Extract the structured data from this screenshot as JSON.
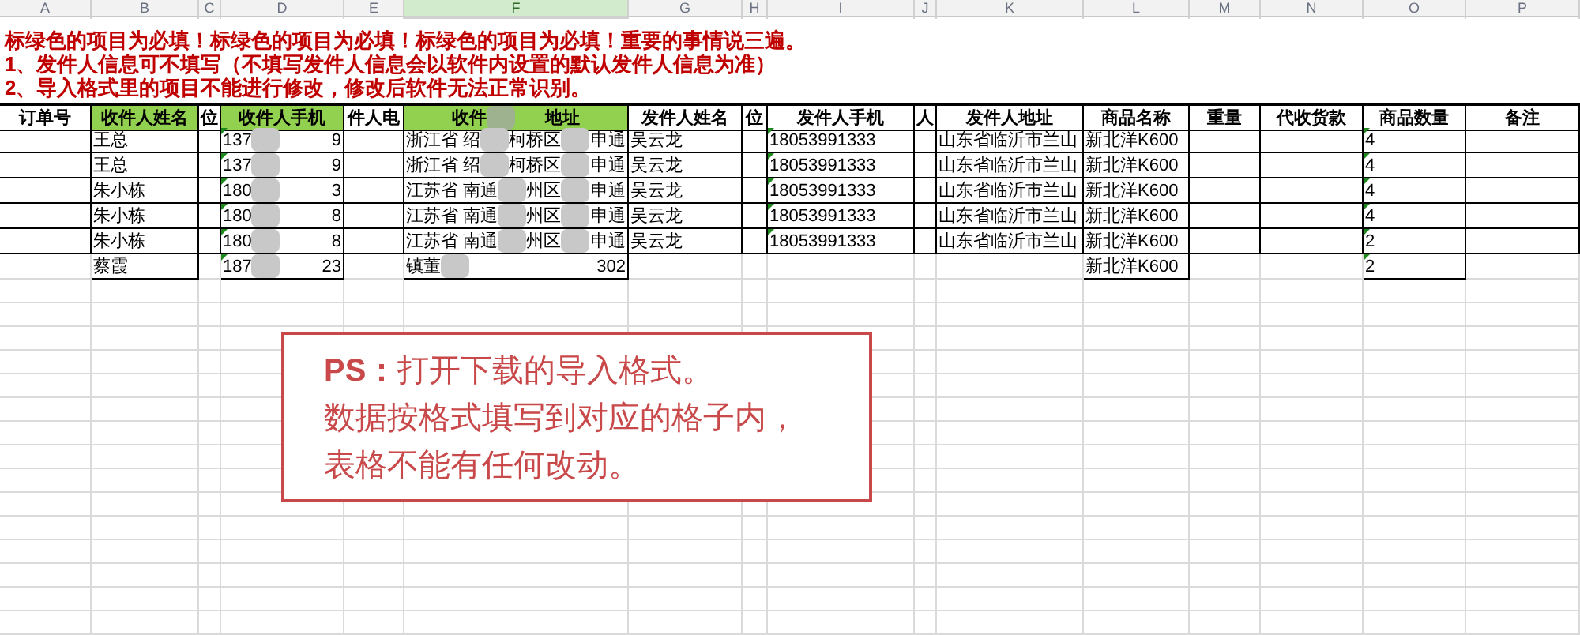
{
  "column_letters": [
    {
      "label": "A",
      "selected": false
    },
    {
      "label": "B",
      "selected": false
    },
    {
      "label": "C",
      "selected": false
    },
    {
      "label": "D",
      "selected": false
    },
    {
      "label": "E",
      "selected": false
    },
    {
      "label": "F",
      "selected": true
    },
    {
      "label": "G",
      "selected": false
    },
    {
      "label": "H",
      "selected": false
    },
    {
      "label": "I",
      "selected": false
    },
    {
      "label": "J",
      "selected": false
    },
    {
      "label": "K",
      "selected": false
    },
    {
      "label": "L",
      "selected": false
    },
    {
      "label": "M",
      "selected": false
    },
    {
      "label": "N",
      "selected": false
    },
    {
      "label": "O",
      "selected": false
    },
    {
      "label": "P",
      "selected": false
    }
  ],
  "notes": [
    "标绿色的项目为必填！标绿色的项目为必填！标绿色的项目为必填！重要的事情说三遍。",
    "1、发件人信息可不填写（不填写发件人信息会以软件内设置的默认发件人信息为准）",
    "2、导入格式里的项目不能进行修改，修改后软件无法正常识别。"
  ],
  "table": {
    "columns": [
      {
        "label": [
          "订单号"
        ],
        "required": false,
        "number_as_text": false
      },
      {
        "label": [
          "收件人姓名"
        ],
        "required": true,
        "number_as_text": false
      },
      {
        "label": [
          "位"
        ],
        "required": false,
        "number_as_text": false
      },
      {
        "label": [
          "收件人手机"
        ],
        "required": true,
        "number_as_text": true
      },
      {
        "label": [
          "件人电"
        ],
        "required": false,
        "number_as_text": false
      },
      {
        "label": [
          "收件",
          "地址"
        ],
        "required": true,
        "number_as_text": false
      },
      {
        "label": [
          "发件人姓名"
        ],
        "required": false,
        "number_as_text": false
      },
      {
        "label": [
          "位"
        ],
        "required": false,
        "number_as_text": false
      },
      {
        "label": [
          "发件人手机"
        ],
        "required": false,
        "number_as_text": true
      },
      {
        "label": [
          "人"
        ],
        "required": false,
        "number_as_text": false
      },
      {
        "label": [
          "发件人地址"
        ],
        "required": false,
        "number_as_text": false
      },
      {
        "label": [
          "商品名称"
        ],
        "required": false,
        "number_as_text": false
      },
      {
        "label": [
          "重量"
        ],
        "required": false,
        "number_as_text": false
      },
      {
        "label": [
          "代收货款"
        ],
        "required": false,
        "number_as_text": false
      },
      {
        "label": [
          "商品数量"
        ],
        "required": false,
        "number_as_text": true
      },
      {
        "label": [
          "备注"
        ],
        "required": false,
        "number_as_text": false
      }
    ],
    "rows": [
      {
        "cells": {
          "B": [
            "王总"
          ],
          "D": [
            "137",
            "9"
          ],
          "F": [
            "浙江省 绍",
            "柯桥区",
            "申通"
          ],
          "G": [
            "吴云龙"
          ],
          "I": [
            "18053991333"
          ],
          "K": [
            "山东省临沂市兰山"
          ],
          "L": [
            "新北洋K600"
          ],
          "O": [
            "4"
          ]
        }
      },
      {
        "cells": {
          "B": [
            "王总"
          ],
          "D": [
            "137",
            "9"
          ],
          "F": [
            "浙江省 绍",
            "柯桥区",
            "申通"
          ],
          "G": [
            "吴云龙"
          ],
          "I": [
            "18053991333"
          ],
          "K": [
            "山东省临沂市兰山"
          ],
          "L": [
            "新北洋K600"
          ],
          "O": [
            "4"
          ]
        }
      },
      {
        "cells": {
          "B": [
            "朱小栋"
          ],
          "D": [
            "180",
            "3"
          ],
          "F": [
            "江苏省 南通",
            "州区",
            "申通"
          ],
          "G": [
            "吴云龙"
          ],
          "I": [
            "18053991333"
          ],
          "K": [
            "山东省临沂市兰山"
          ],
          "L": [
            "新北洋K600"
          ],
          "O": [
            "4"
          ]
        }
      },
      {
        "cells": {
          "B": [
            "朱小栋"
          ],
          "D": [
            "180",
            "8"
          ],
          "F": [
            "江苏省 南通",
            "州区",
            "申通"
          ],
          "G": [
            "吴云龙"
          ],
          "I": [
            "18053991333"
          ],
          "K": [
            "山东省临沂市兰山"
          ],
          "L": [
            "新北洋K600"
          ],
          "O": [
            "4"
          ]
        }
      },
      {
        "cells": {
          "B": [
            "朱小栋"
          ],
          "D": [
            "180",
            "8"
          ],
          "F": [
            "江苏省 南通",
            "州区",
            "申通"
          ],
          "G": [
            "吴云龙"
          ],
          "I": [
            "18053991333"
          ],
          "K": [
            "山东省临沂市兰山"
          ],
          "L": [
            "新北洋K600"
          ],
          "O": [
            "2"
          ]
        }
      },
      {
        "cells": {
          "B": [
            "蔡霞"
          ],
          "D": [
            "187",
            "23"
          ],
          "F": [
            "镇董",
            "302"
          ],
          "L": [
            "新北洋K600"
          ],
          "O": [
            "2"
          ]
        }
      }
    ]
  },
  "callout": [
    "**PS：**打开下载的导入格式。",
    "数据按格式填写到对应的格子内，",
    "表格不能有任何改动。"
  ]
}
